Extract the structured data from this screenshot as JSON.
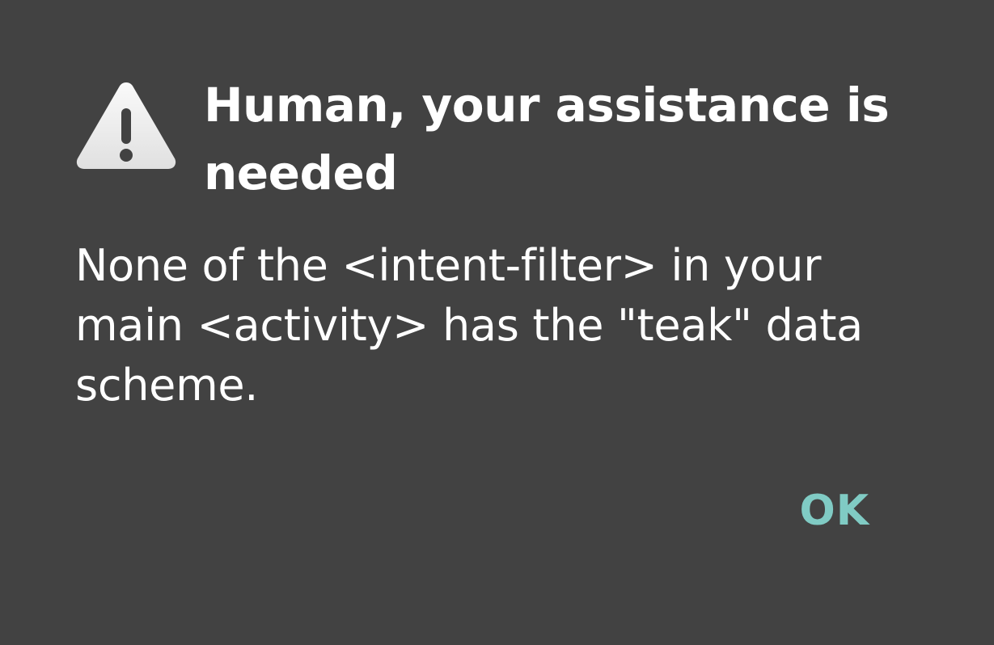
{
  "dialog": {
    "icon": "warning-icon",
    "title": "Human, your assistance is needed",
    "message": "None of the <intent-filter> in your main <activity> has the \"teak\" data scheme.",
    "ok_label": "OK"
  },
  "colors": {
    "background": "#424242",
    "text": "#ffffff",
    "accent": "#80cbc4"
  }
}
